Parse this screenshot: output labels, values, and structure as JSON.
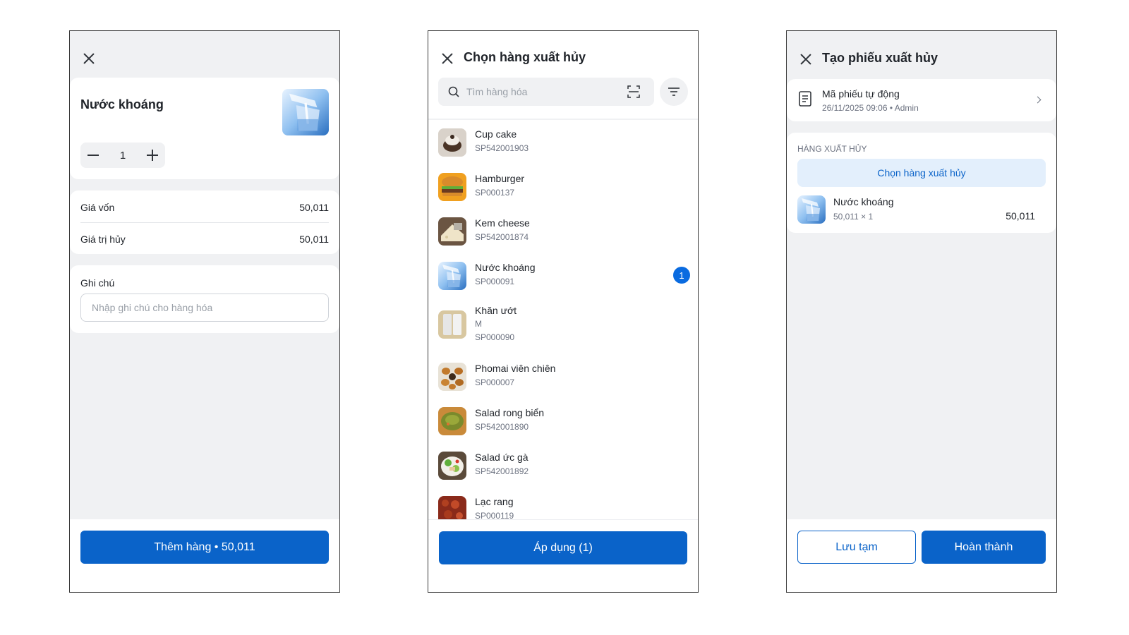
{
  "screen1": {
    "product_name": "Nước khoáng",
    "quantity": "1",
    "cost_label": "Giá vốn",
    "cost_value": "50,011",
    "dispose_value_label": "Giá trị hủy",
    "dispose_value": "50,011",
    "note_label": "Ghi chú",
    "note_placeholder": "Nhập ghi chú cho hàng hóa",
    "add_button": "Thêm hàng • 50,011"
  },
  "screen2": {
    "title": "Chọn hàng xuất hủy",
    "search_placeholder": "Tìm hàng hóa",
    "items": [
      {
        "name": "Cup cake",
        "code": "SP542001903",
        "variant": "",
        "badge": "",
        "icon": "cupcake-thumb"
      },
      {
        "name": "Hamburger",
        "code": "SP000137",
        "variant": "",
        "badge": "",
        "icon": "hamburger-thumb"
      },
      {
        "name": "Kem cheese",
        "code": "SP542001874",
        "variant": "",
        "badge": "",
        "icon": "cheese-thumb"
      },
      {
        "name": "Nước khoáng",
        "code": "SP000091",
        "variant": "",
        "badge": "1",
        "icon": "water-thumb"
      },
      {
        "name": "Khăn ướt",
        "code": "SP000090",
        "variant": "M",
        "badge": "",
        "icon": "wet-wipes-thumb"
      },
      {
        "name": "Phomai viên chiên",
        "code": "SP000007",
        "variant": "",
        "badge": "",
        "icon": "fried-cheese-thumb"
      },
      {
        "name": "Salad rong biển",
        "code": "SP542001890",
        "variant": "",
        "badge": "",
        "icon": "seaweed-salad-thumb"
      },
      {
        "name": "Salad ức gà",
        "code": "SP542001892",
        "variant": "",
        "badge": "",
        "icon": "chicken-salad-thumb"
      },
      {
        "name": "Lạc rang",
        "code": "SP000119",
        "variant": "",
        "badge": "",
        "icon": "peanuts-thumb"
      }
    ],
    "apply_button": "Áp dụng (1)"
  },
  "screen3": {
    "title": "Tạo phiếu xuất hủy",
    "ticket_code": "Mã phiếu tự động",
    "ticket_meta": "26/11/2025 09:06 • Admin",
    "section_label": "HÀNG XUẤT HỦY",
    "choose_button": "Chọn hàng xuất hủy",
    "item_name": "Nước khoáng",
    "item_calc": "50,011 × 1",
    "item_total": "50,011",
    "save_button": "Lưu tạm",
    "complete_button": "Hoàn thành"
  },
  "colors": {
    "primary": "#0a63c9",
    "badge": "#0a6be0",
    "background": "#f0f1f3",
    "light_blue": "#e3effc"
  }
}
